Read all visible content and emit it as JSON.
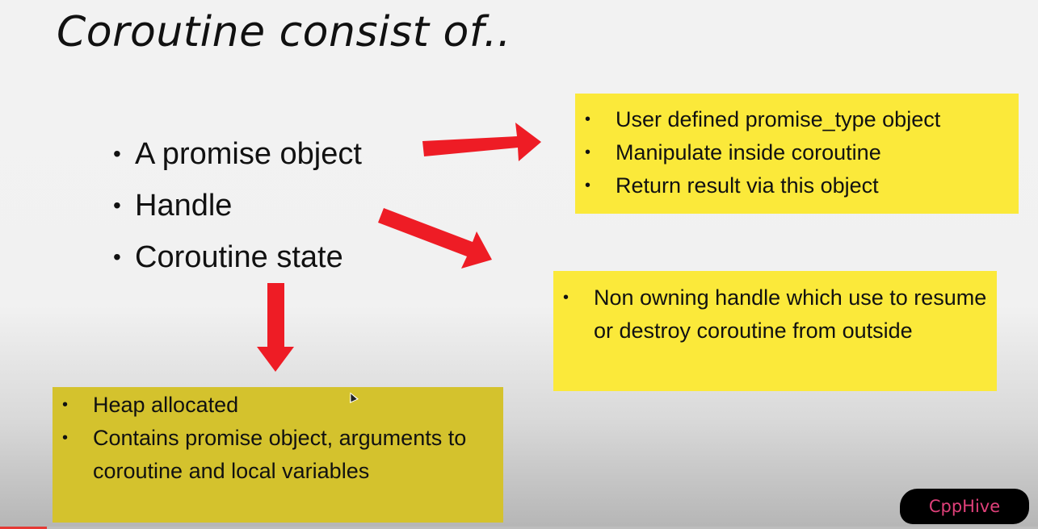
{
  "slide": {
    "title": "Coroutine consist of..",
    "main_items": [
      "A promise object",
      "Handle",
      "Coroutine state"
    ]
  },
  "boxes": {
    "promise": {
      "items": [
        "User defined promise_type object",
        "Manipulate inside coroutine",
        "Return result via this object"
      ],
      "color": "#fbe93a"
    },
    "handle": {
      "items": [
        "Non owning handle which use to resume or destroy coroutine from outside"
      ],
      "color": "#fbe93a"
    },
    "state": {
      "items": [
        "Heap allocated",
        "Contains promise object, arguments to coroutine and local variables"
      ],
      "color": "#d4c22d"
    }
  },
  "watermark": {
    "label": "CppHive",
    "color": "#e0407a"
  },
  "colors": {
    "arrow": "#ee1c25"
  },
  "video": {
    "progress": 0.045
  }
}
